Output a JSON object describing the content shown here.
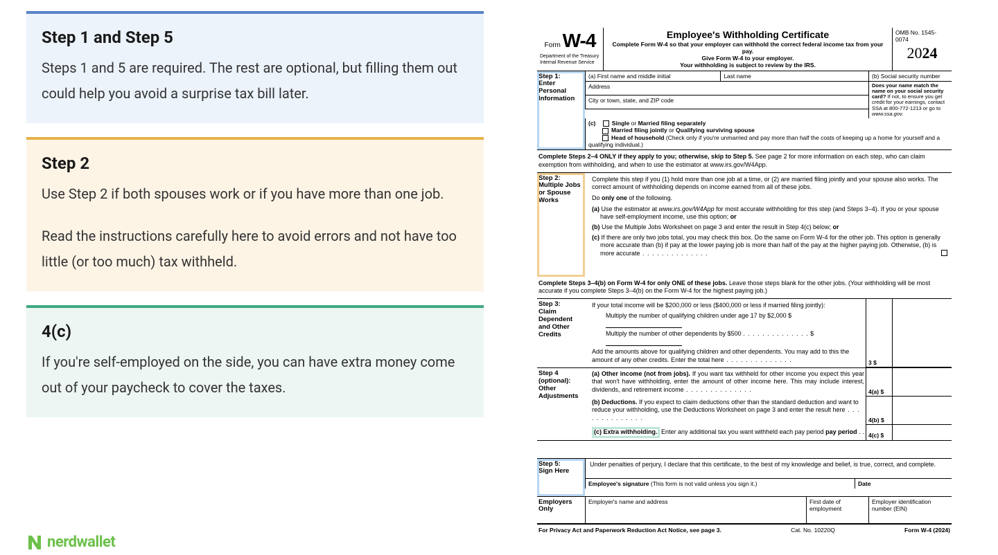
{
  "cards": {
    "c1": {
      "title": "Step 1 and Step 5",
      "p1": "Steps 1 and 5 are required. The rest are optional, but filling them out could help you avoid a surprise tax bill later."
    },
    "c2": {
      "title": "Step 2",
      "p1": "Use Step 2 if both spouses work or if you have more than one job.",
      "p2": "Read the instructions carefully here to avoid errors and not have too little (or too much) tax withheld."
    },
    "c3": {
      "title": "4(c)",
      "p1": "If you're self-employed on the side, you can have extra money come out of your paycheck to cover the taxes."
    }
  },
  "brand": "nerdwallet",
  "form": {
    "form_word": "Form",
    "form_code": "W-4",
    "dept1": "Department of the Treasury",
    "dept2": "Internal Revenue Service",
    "title": "Employee's Withholding Certificate",
    "sub1": "Complete Form W-4 so that your employer can withhold the correct federal income tax from your pay.",
    "sub2": "Give Form W-4 to your employer.",
    "sub3": "Your withholding is subject to review by the IRS.",
    "omb": "OMB No. 1545-0074",
    "year_a": "20",
    "year_b": "24",
    "s1_label1": "Step 1:",
    "s1_label2": "Enter Personal Information",
    "s1_a": "(a)  First name and middle initial",
    "s1_last": "Last name",
    "s1_b": "(b)  Social security number",
    "s1_addr": "Address",
    "s1_city": "City or town, state, and ZIP code",
    "ssa_note": "Does your name match the name on your social security card? If not, to ensure you get credit for your earnings, contact SSA at 800-772-1213 or go to www.ssa.gov.",
    "s1_c": "(c)",
    "opt1": "Single or Married filing separately",
    "opt2": "Married filing jointly or Qualifying surviving spouse",
    "opt3": "Head of household (Check only if you're unmarried and pay more than half the costs of keeping up a home for yourself and a qualifying individual.)",
    "note1a": "Complete Steps 2–4 ONLY if they apply to you; otherwise, skip to Step 5. ",
    "note1b": "See page 2 for more information on each step, who can claim exemption from withholding, and when to use the estimator at www.irs.gov/W4App.",
    "s2_label1": "Step 2:",
    "s2_label2": "Multiple Jobs or Spouse Works",
    "s2_intro": "Complete this step if you (1) hold more than one job at a time, or (2) are married filing jointly and your spouse also works. The correct amount of withholding depends on income earned from all of these jobs.",
    "s2_doonly": "Do only one of the following.",
    "s2_a": "(a) Use the estimator at www.irs.gov/W4App for most accurate withholding for this step (and Steps 3–4). If you or your spouse have self-employment income, use this option; or",
    "s2_b": "(b) Use the Multiple Jobs Worksheet on page 3 and enter the result in Step 4(c) below; or",
    "s2_c": "(c) If there are only two jobs total, you may check this box. Do the same on Form W-4 for the other job. This option is generally more accurate than (b) if pay at the lower paying job is more than half of the pay at the higher paying job. Otherwise, (b) is more accurate",
    "note2a": "Complete Steps 3–4(b) on Form W-4 for only ONE of these jobs. ",
    "note2b": "Leave those steps blank for the other jobs. (Your withholding will be most accurate if you complete Steps 3–4(b) on the Form W-4 for the highest paying job.)",
    "s3_label1": "Step 3:",
    "s3_label2": "Claim Dependent and Other Credits",
    "s3_intro": "If your total income will be $200,000 or less ($400,000 or less if married filing jointly):",
    "s3_kids": "Multiply the number of qualifying children under age 17 by $2,000  $",
    "s3_other": "Multiply the number of other dependents by $500",
    "s3_add": "Add the amounts above for qualifying children and other dependents. You may add to this the amount of any other credits. Enter the total here",
    "s3_amt": "3    $",
    "s4_label1": "Step 4 (optional):",
    "s4_label2": "Other Adjustments",
    "s4_a_t": "(a) Other income (not from jobs).",
    "s4_a": " If you want tax withheld for other income you expect this year that won't have withholding, enter the amount of other income here. This may include interest, dividends, and retirement income",
    "s4_a_amt": "4(a) $",
    "s4_b_t": "(b) Deductions.",
    "s4_b": " If you expect to claim deductions other than the standard deduction and want to reduce your withholding, use the Deductions Worksheet on page 3 and enter the result here",
    "s4_b_amt": "4(b) $",
    "s4_c_t": "(c) Extra withholding.",
    "s4_c": " Enter any additional tax you want withheld each pay period",
    "s4_c_amt": "4(c) $",
    "s5_label1": "Step 5:",
    "s5_label2": "Sign Here",
    "s5_decl": "Under penalties of perjury, I declare that this certificate, to the best of my knowledge and belief, is true, correct, and complete.",
    "s5_sig": "Employee's signature (This form is not valid unless you sign it.)",
    "s5_date": "Date",
    "emp_label": "Employers Only",
    "emp_name": "Employer's name and address",
    "emp_first": "First date of employment",
    "emp_ein": "Employer identification number (EIN)",
    "ftr_l": "For Privacy Act and Paperwork Reduction Act Notice, see page 3.",
    "ftr_c": "Cat. No. 10220Q",
    "ftr_r": "Form W-4 (2024)"
  }
}
